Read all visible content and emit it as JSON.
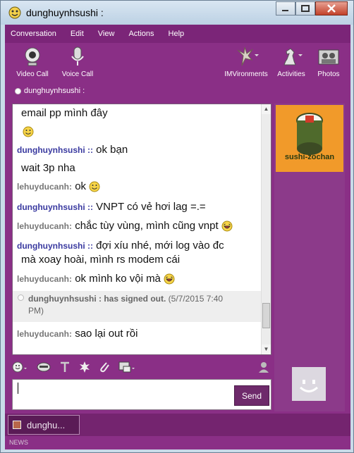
{
  "window": {
    "title": "dunghuynhsushi :"
  },
  "menu": [
    "Conversation",
    "Edit",
    "View",
    "Actions",
    "Help"
  ],
  "toolbar": {
    "video_call": "Video Call",
    "voice_call": "Voice Call",
    "imvironments": "IMVironments",
    "activities": "Activities",
    "photos": "Photos"
  },
  "contact_status": "dunghuynhsushi :",
  "chat": {
    "lines": [
      {
        "nick": "",
        "text": "email pp mình đây"
      },
      {
        "nick": "dunghuynhsushi ::",
        "text": "ok bạn"
      },
      {
        "nick": "",
        "text": "wait 3p nha"
      },
      {
        "nick": "lehuyducanh:",
        "text": "ok"
      },
      {
        "nick": "dunghuynhsushi ::",
        "text": "VNPT có vẻ hơi lag =.="
      },
      {
        "nick": "lehuyducanh:",
        "text": "chắc tùy vùng, mình cũng vnpt"
      },
      {
        "nick": "dunghuynhsushi ::",
        "text": "đợi xíu nhé, mới log vào đc"
      },
      {
        "nick": "",
        "text": "mà xoay hoài, mình rs modem cái"
      },
      {
        "nick": "lehuyducanh:",
        "text": "ok mình ko vội mà"
      },
      {
        "nick": "lehuyducanh:",
        "text": "sao lại out rồi"
      }
    ],
    "system_name": "dunghuynhsushi : has signed out.",
    "system_time": "(5/7/2015 7:40",
    "system_time2": "PM)"
  },
  "avatar": {
    "banner_text": "sushi-zochan"
  },
  "input": {
    "send_label": "Send"
  },
  "taskbar": {
    "tab_label": "dunghu..."
  },
  "news_label": "NEWS",
  "colors": {
    "frame": "#8a2f86",
    "menubar": "#7b2578",
    "nick_blue": "#3a3aa0",
    "nick_gray": "#777777"
  }
}
